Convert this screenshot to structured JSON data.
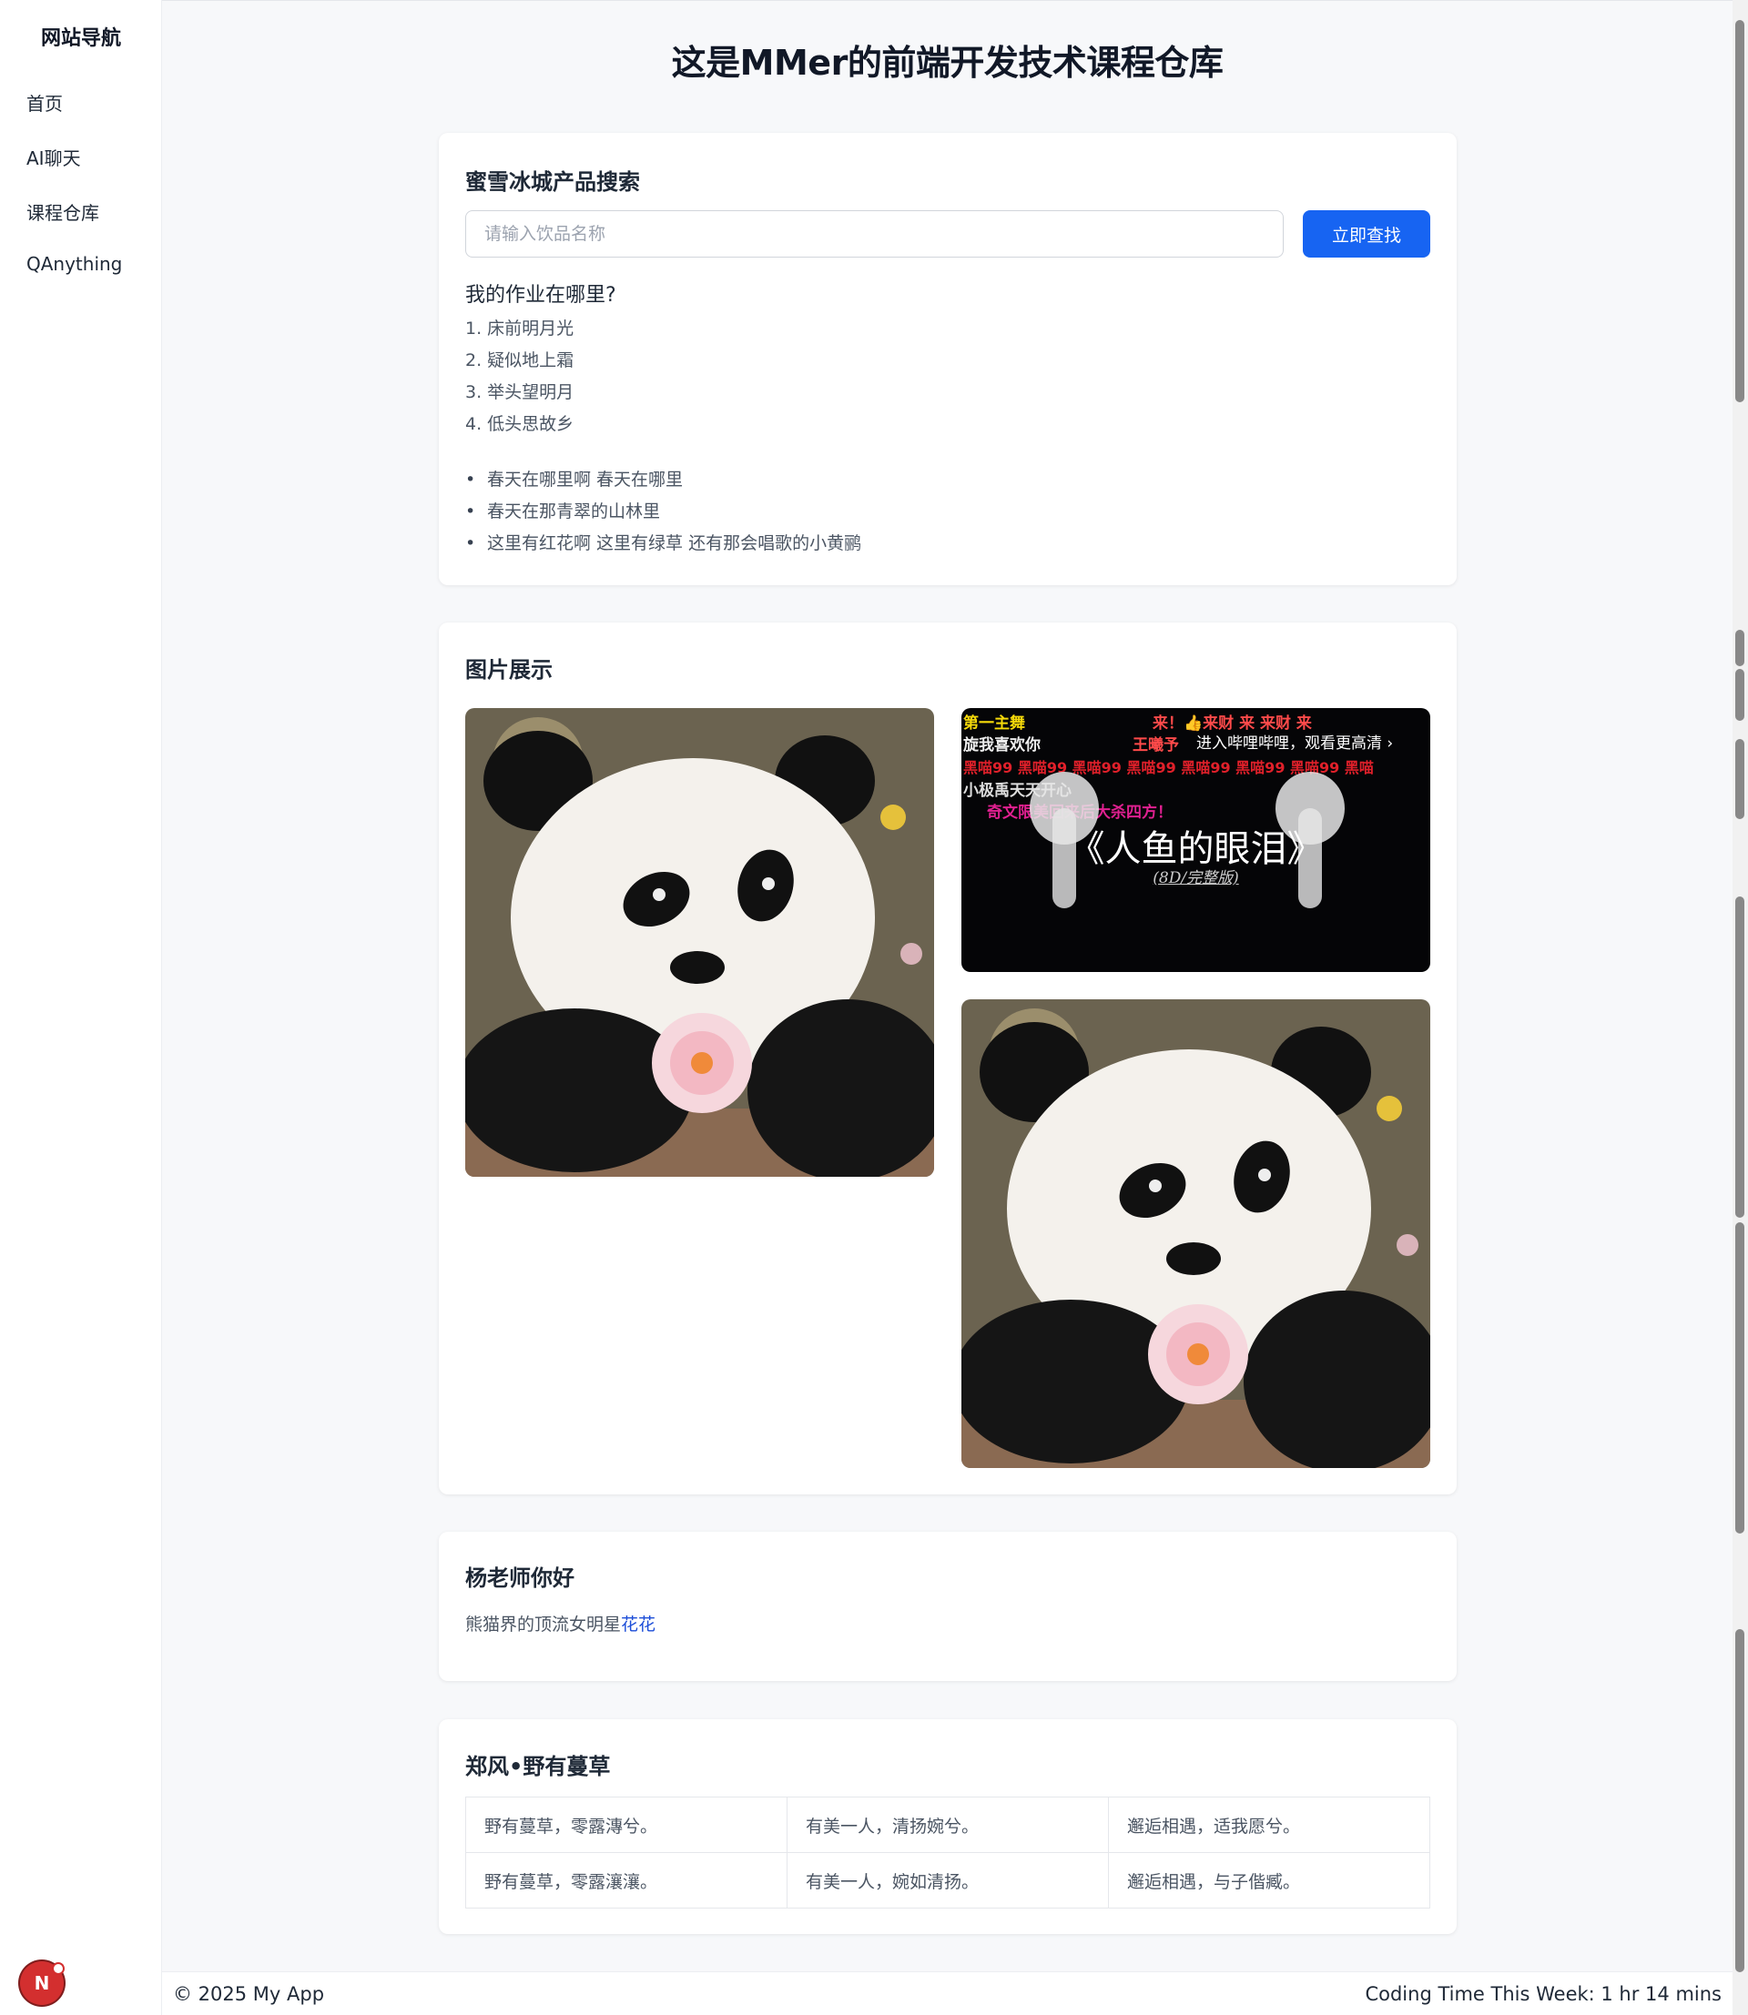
{
  "sidebar": {
    "title": "网站导航",
    "items": [
      {
        "label": "首页"
      },
      {
        "label": "AI聊天"
      },
      {
        "label": "课程仓库"
      },
      {
        "label": "QAnything"
      }
    ]
  },
  "page": {
    "title": "这是MMer的前端开发技术课程仓库"
  },
  "search_card": {
    "title": "蜜雪冰城产品搜索",
    "placeholder": "请输入饮品名称",
    "button_label": "立即查找",
    "subhead": "我的作业在哪里?",
    "ordered_list": [
      "1. 床前明月光",
      "2. 疑似地上霜",
      "3. 举头望明月",
      "4. 低头思故乡"
    ],
    "bullet_list": [
      "春天在哪里啊 春天在哪里",
      "春天在那青翠的山林里",
      "这里有红花啊 这里有绿草 还有那会唱歌的小黄鹂"
    ]
  },
  "gallery_card": {
    "title": "图片展示",
    "video_overlay": {
      "danmaku_1": "第一主舞",
      "danmaku_2": "来！👍来财 来 来财 来",
      "danmaku_3": "进入哔哩哔哩，观看更高清 ›",
      "danmaku_4": "王曦予",
      "danmaku_5": "旋我喜欢你",
      "danmaku_6": "黑喵99 黑喵99 黑喵99 黑喵99 黑喵99 黑喵99 黑喵99 黑喵",
      "danmaku_7": "小极禹天天开心",
      "danmaku_8": "奇文限美回来后大杀四方！",
      "song_title": "《人鱼的眼泪》",
      "song_sub": "(8D/完整版)"
    }
  },
  "teacher_card": {
    "title": "杨老师你好",
    "text": "熊猫界的顶流女明星",
    "link_text": "花花"
  },
  "poem_card": {
    "title": "郑风•野有蔓草",
    "rows": [
      [
        "野有蔓草，零露漙兮。",
        "有美一人，清扬婉兮。",
        "邂逅相遇，适我愿兮。"
      ],
      [
        "野有蔓草，零露瀼瀼。",
        "有美一人，婉如清扬。",
        "邂逅相遇，与子偕臧。"
      ]
    ]
  },
  "footer": {
    "copyright": "© 2025 My App",
    "coding_time": "Coding Time This Week: 1 hr 14 mins"
  },
  "dev_badge": {
    "letter": "N"
  },
  "colors": {
    "accent": "#1764f2",
    "link": "#1d4ed8",
    "badge": "#d32f2f"
  }
}
